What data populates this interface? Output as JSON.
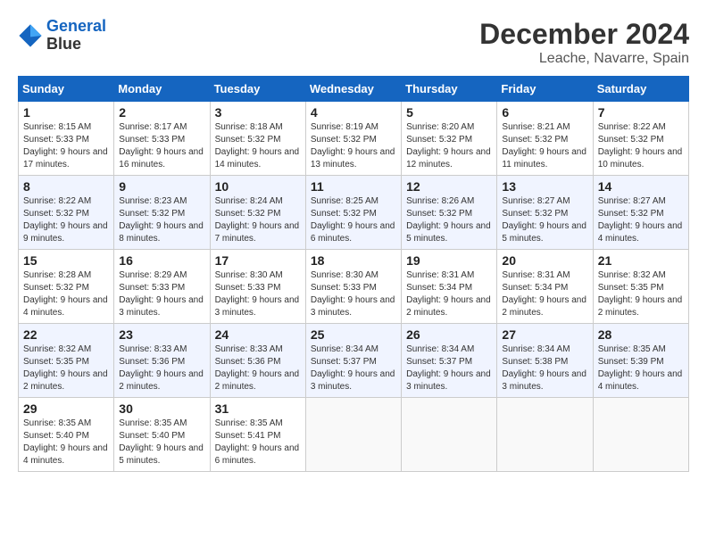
{
  "logo": {
    "line1": "General",
    "line2": "Blue"
  },
  "title": "December 2024",
  "subtitle": "Leache, Navarre, Spain",
  "days_of_week": [
    "Sunday",
    "Monday",
    "Tuesday",
    "Wednesday",
    "Thursday",
    "Friday",
    "Saturday"
  ],
  "weeks": [
    [
      {
        "day": "1",
        "info": "Sunrise: 8:15 AM\nSunset: 5:33 PM\nDaylight: 9 hours and 17 minutes."
      },
      {
        "day": "2",
        "info": "Sunrise: 8:17 AM\nSunset: 5:33 PM\nDaylight: 9 hours and 16 minutes."
      },
      {
        "day": "3",
        "info": "Sunrise: 8:18 AM\nSunset: 5:32 PM\nDaylight: 9 hours and 14 minutes."
      },
      {
        "day": "4",
        "info": "Sunrise: 8:19 AM\nSunset: 5:32 PM\nDaylight: 9 hours and 13 minutes."
      },
      {
        "day": "5",
        "info": "Sunrise: 8:20 AM\nSunset: 5:32 PM\nDaylight: 9 hours and 12 minutes."
      },
      {
        "day": "6",
        "info": "Sunrise: 8:21 AM\nSunset: 5:32 PM\nDaylight: 9 hours and 11 minutes."
      },
      {
        "day": "7",
        "info": "Sunrise: 8:22 AM\nSunset: 5:32 PM\nDaylight: 9 hours and 10 minutes."
      }
    ],
    [
      {
        "day": "8",
        "info": "Sunrise: 8:22 AM\nSunset: 5:32 PM\nDaylight: 9 hours and 9 minutes."
      },
      {
        "day": "9",
        "info": "Sunrise: 8:23 AM\nSunset: 5:32 PM\nDaylight: 9 hours and 8 minutes."
      },
      {
        "day": "10",
        "info": "Sunrise: 8:24 AM\nSunset: 5:32 PM\nDaylight: 9 hours and 7 minutes."
      },
      {
        "day": "11",
        "info": "Sunrise: 8:25 AM\nSunset: 5:32 PM\nDaylight: 9 hours and 6 minutes."
      },
      {
        "day": "12",
        "info": "Sunrise: 8:26 AM\nSunset: 5:32 PM\nDaylight: 9 hours and 5 minutes."
      },
      {
        "day": "13",
        "info": "Sunrise: 8:27 AM\nSunset: 5:32 PM\nDaylight: 9 hours and 5 minutes."
      },
      {
        "day": "14",
        "info": "Sunrise: 8:27 AM\nSunset: 5:32 PM\nDaylight: 9 hours and 4 minutes."
      }
    ],
    [
      {
        "day": "15",
        "info": "Sunrise: 8:28 AM\nSunset: 5:32 PM\nDaylight: 9 hours and 4 minutes."
      },
      {
        "day": "16",
        "info": "Sunrise: 8:29 AM\nSunset: 5:33 PM\nDaylight: 9 hours and 3 minutes."
      },
      {
        "day": "17",
        "info": "Sunrise: 8:30 AM\nSunset: 5:33 PM\nDaylight: 9 hours and 3 minutes."
      },
      {
        "day": "18",
        "info": "Sunrise: 8:30 AM\nSunset: 5:33 PM\nDaylight: 9 hours and 3 minutes."
      },
      {
        "day": "19",
        "info": "Sunrise: 8:31 AM\nSunset: 5:34 PM\nDaylight: 9 hours and 2 minutes."
      },
      {
        "day": "20",
        "info": "Sunrise: 8:31 AM\nSunset: 5:34 PM\nDaylight: 9 hours and 2 minutes."
      },
      {
        "day": "21",
        "info": "Sunrise: 8:32 AM\nSunset: 5:35 PM\nDaylight: 9 hours and 2 minutes."
      }
    ],
    [
      {
        "day": "22",
        "info": "Sunrise: 8:32 AM\nSunset: 5:35 PM\nDaylight: 9 hours and 2 minutes."
      },
      {
        "day": "23",
        "info": "Sunrise: 8:33 AM\nSunset: 5:36 PM\nDaylight: 9 hours and 2 minutes."
      },
      {
        "day": "24",
        "info": "Sunrise: 8:33 AM\nSunset: 5:36 PM\nDaylight: 9 hours and 2 minutes."
      },
      {
        "day": "25",
        "info": "Sunrise: 8:34 AM\nSunset: 5:37 PM\nDaylight: 9 hours and 3 minutes."
      },
      {
        "day": "26",
        "info": "Sunrise: 8:34 AM\nSunset: 5:37 PM\nDaylight: 9 hours and 3 minutes."
      },
      {
        "day": "27",
        "info": "Sunrise: 8:34 AM\nSunset: 5:38 PM\nDaylight: 9 hours and 3 minutes."
      },
      {
        "day": "28",
        "info": "Sunrise: 8:35 AM\nSunset: 5:39 PM\nDaylight: 9 hours and 4 minutes."
      }
    ],
    [
      {
        "day": "29",
        "info": "Sunrise: 8:35 AM\nSunset: 5:40 PM\nDaylight: 9 hours and 4 minutes."
      },
      {
        "day": "30",
        "info": "Sunrise: 8:35 AM\nSunset: 5:40 PM\nDaylight: 9 hours and 5 minutes."
      },
      {
        "day": "31",
        "info": "Sunrise: 8:35 AM\nSunset: 5:41 PM\nDaylight: 9 hours and 6 minutes."
      },
      {
        "day": "",
        "info": ""
      },
      {
        "day": "",
        "info": ""
      },
      {
        "day": "",
        "info": ""
      },
      {
        "day": "",
        "info": ""
      }
    ]
  ]
}
